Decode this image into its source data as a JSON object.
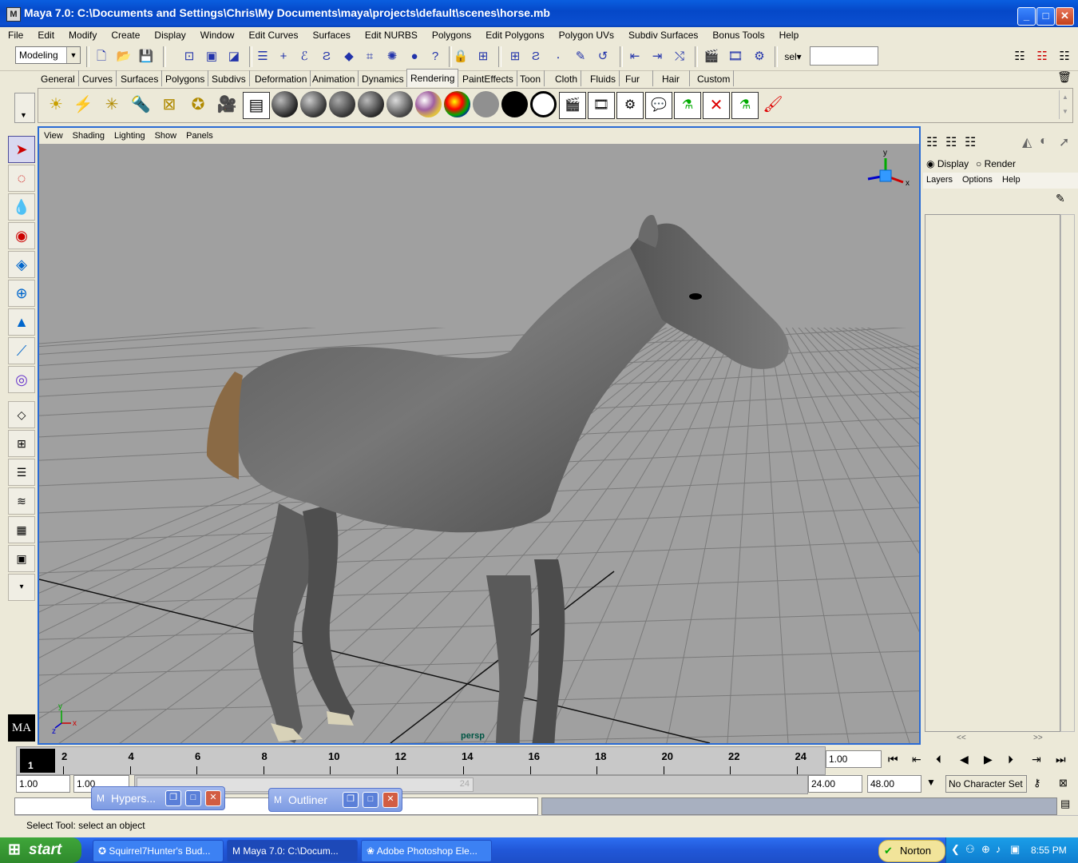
{
  "window": {
    "title": "Maya 7.0: C:\\Documents and Settings\\Chris\\My Documents\\maya\\projects\\default\\scenes\\horse.mb",
    "app_icon": "M",
    "min_label": "_",
    "max_label": "□",
    "close_label": "✕"
  },
  "menu": [
    "File",
    "Edit",
    "Modify",
    "Create",
    "Display",
    "Window",
    "Edit Curves",
    "Surfaces",
    "Edit NURBS",
    "Polygons",
    "Edit Polygons",
    "Polygon UVs",
    "Subdiv Surfaces",
    "Bonus Tools",
    "Help"
  ],
  "statusline": {
    "mode": "Modeling",
    "sel_label": "sel"
  },
  "shelf_tabs": [
    "General",
    "Curves",
    "Surfaces",
    "Polygons",
    "Subdivs",
    "Deformation",
    "Animation",
    "Dynamics",
    "Rendering",
    "PaintEffects",
    "Toon",
    "Cloth",
    "Fluids",
    "Fur",
    "Hair",
    "Custom"
  ],
  "shelf_active": "Rendering",
  "viewport": {
    "menu": [
      "View",
      "Shading",
      "Lighting",
      "Show",
      "Panels"
    ],
    "camera": "persp",
    "axis_x": "x",
    "axis_y": "y",
    "axis_z": "z"
  },
  "channel_box": {
    "opt_display": "Display",
    "opt_render": "Render",
    "menu": [
      "Layers",
      "Options",
      "Help"
    ],
    "scroll_left": "<<",
    "scroll_right": ">>"
  },
  "timeline": {
    "current_frame": "1",
    "ticks": [
      "2",
      "4",
      "6",
      "8",
      "10",
      "12",
      "14",
      "16",
      "18",
      "20",
      "22",
      "24"
    ],
    "current_time": "1.00"
  },
  "range": {
    "start": "1.00",
    "playback_start": "1.00",
    "slider_end": "24",
    "playback_end": "24.00",
    "end": "48.00",
    "character_set": "No Character Set"
  },
  "help_line": "Select Tool: select an object",
  "floating": [
    {
      "label": "Hypers..."
    },
    {
      "label": "Outliner"
    }
  ],
  "taskbar": {
    "start": "start",
    "items": [
      "Squirrel7Hunter's Bud...",
      "Maya 7.0: C:\\Docum...",
      "Adobe Photoshop Ele..."
    ],
    "norton": "Norton",
    "clock": "8:55 PM"
  },
  "colors": {
    "viewport_bg": "#a0a0a0",
    "grid": "#7a7a7a",
    "horse": "#6a6a6a",
    "mane": "#8a6a45",
    "hoof": "#d8d2b8",
    "viewport_border": "#2a6bd4"
  }
}
